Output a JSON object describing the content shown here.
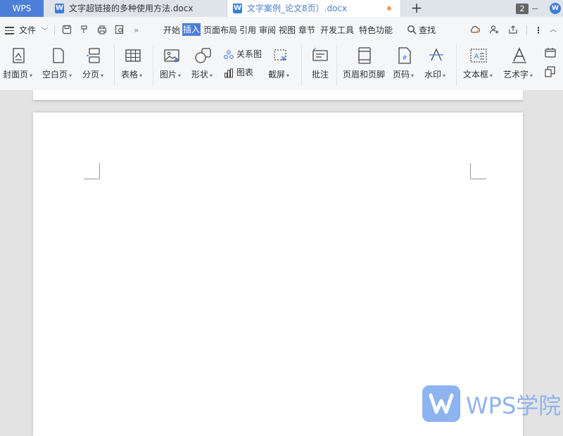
{
  "tabs": {
    "app_label": "WPS",
    "doc1": "文字超链接的多种使用方法.docx",
    "doc2": "文字案例_论文8页）.docx",
    "count": "2"
  },
  "menu": {
    "file": "文件",
    "tabs": [
      "开始",
      "插入",
      "页面布局",
      "引用",
      "审阅",
      "视图",
      "章节",
      "开发工具",
      "特色功能"
    ],
    "active_tab": "插入",
    "search": "查找"
  },
  "ribbon": {
    "cover": "封面页",
    "blank": "空白页",
    "page_break": "分页",
    "table": "表格",
    "picture": "图片",
    "shape": "形状",
    "smartart": "关系图",
    "chart": "图表",
    "screenshot": "截屏",
    "comment": "批注",
    "header_footer": "页眉和页脚",
    "page_number": "页码",
    "watermark": "水印",
    "textbox": "文本框",
    "wordart": "艺术字"
  },
  "watermark_brand": "WPS学院",
  "colors": {
    "accent": "#4a7fd8",
    "wps_tab": "#4d7fd8",
    "modified_dot": "#f59a4e"
  }
}
